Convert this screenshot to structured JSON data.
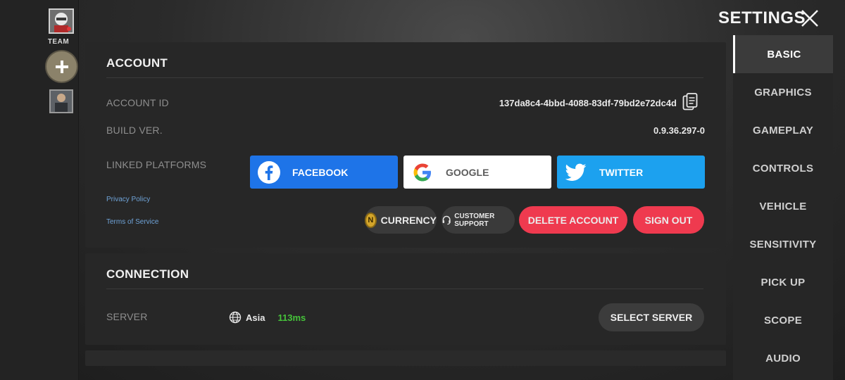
{
  "header": {
    "title": "SETTINGS"
  },
  "left_strip": {
    "team_label": "TEAM"
  },
  "nav": {
    "items": [
      {
        "label": "BASIC",
        "active": true
      },
      {
        "label": "GRAPHICS"
      },
      {
        "label": "GAMEPLAY"
      },
      {
        "label": "CONTROLS"
      },
      {
        "label": "VEHICLE"
      },
      {
        "label": "SENSITIVITY"
      },
      {
        "label": "PICK UP"
      },
      {
        "label": "SCOPE"
      },
      {
        "label": "AUDIO"
      }
    ]
  },
  "account": {
    "title": "ACCOUNT",
    "account_id_label": "ACCOUNT ID",
    "account_id": "137da8c4-4bbd-4088-83df-79bd2e72dc4d",
    "build_label": "BUILD VER.",
    "build_value": "0.9.36.297-0",
    "linked_label": "LINKED PLATFORMS",
    "facebook_label": "FACEBOOK",
    "google_label": "GOOGLE",
    "twitter_label": "TWITTER",
    "privacy_policy": "Privacy Policy",
    "terms": "Terms of Service",
    "currency_label": "CURRENCY",
    "currency_badge": "N",
    "support_label": "CUSTOMER SUPPORT",
    "delete_label": "DELETE ACCOUNT",
    "signout_label": "SIGN OUT"
  },
  "connection": {
    "title": "CONNECTION",
    "server_label": "SERVER",
    "region": "Asia",
    "ping": "113ms",
    "select_label": "SELECT SERVER"
  },
  "colors": {
    "accent_red": "#ef3a4f",
    "facebook": "#1e74e8",
    "twitter": "#1ca1ef",
    "ping_green": "#46c33a",
    "link_blue": "#6fa3d8"
  }
}
